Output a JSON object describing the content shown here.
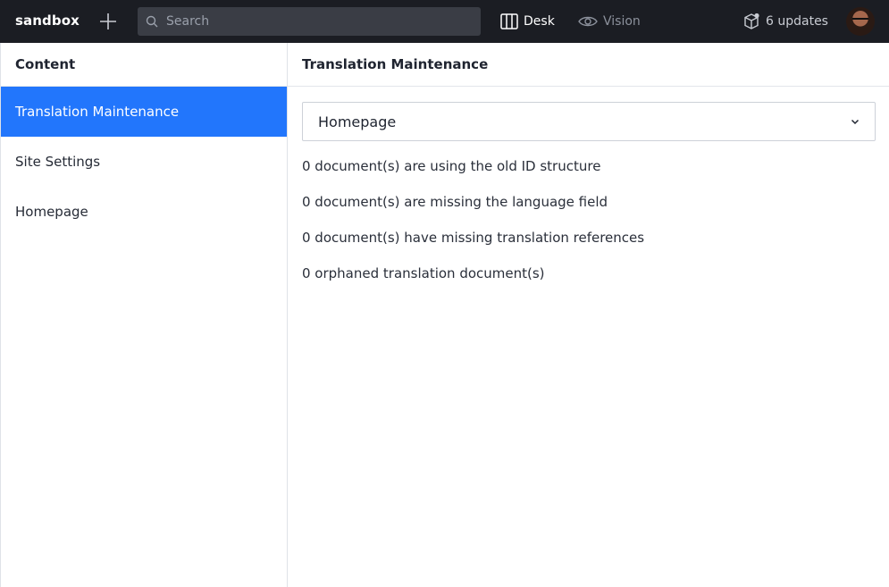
{
  "topbar": {
    "brand": "sandbox",
    "search_placeholder": "Search",
    "desk_label": "Desk",
    "vision_label": "Vision",
    "updates_label": "6 updates",
    "icons": [
      "plus-icon",
      "search-icon",
      "desk-icon",
      "eye-icon",
      "package-icon",
      "avatar"
    ]
  },
  "sidebar": {
    "title": "Content",
    "items": [
      {
        "label": "Translation Maintenance",
        "active": true
      },
      {
        "label": "Site Settings",
        "active": false
      },
      {
        "label": "Homepage",
        "active": false
      }
    ]
  },
  "main": {
    "title": "Translation Maintenance",
    "schema_select": {
      "value": "Homepage"
    },
    "stats": [
      "0 document(s) are using the old ID structure",
      "0 document(s) are missing the language field",
      "0 document(s) have missing translation references",
      "0 orphaned translation document(s)"
    ]
  },
  "colors": {
    "topbar_bg": "#1b1d23",
    "accent": "#2276fc",
    "search_bg": "#3a3d45"
  }
}
